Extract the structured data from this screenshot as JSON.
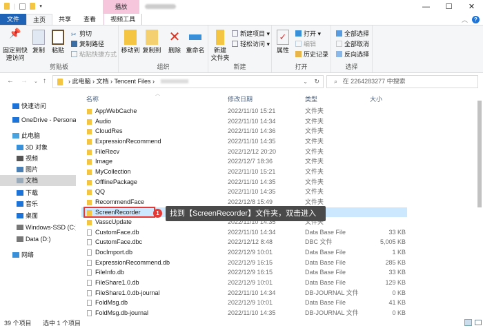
{
  "title_ctx_tab": "播放",
  "window_controls": {
    "minimize": "—",
    "maximize": "☐",
    "close": "✕"
  },
  "tabs": [
    "文件",
    "主页",
    "共享",
    "查看",
    "视频工具"
  ],
  "help": "?",
  "ribbon": {
    "clipboard": {
      "label": "剪贴板",
      "pin": "固定到快速访问",
      "copy": "复制",
      "paste": "粘贴",
      "cut": "剪切",
      "copy_path": "复制路径",
      "paste_shortcut": "粘贴快捷方式"
    },
    "organize": {
      "label": "组织",
      "move_to": "移动到",
      "copy_to": "复制到",
      "delete": "删除",
      "rename": "重命名"
    },
    "new": {
      "label": "新建",
      "new_folder": "新建\n文件夹",
      "new_item": "新建项目 ▾",
      "easy_access": "轻松访问 ▾"
    },
    "open": {
      "label": "打开",
      "properties": "属性",
      "open": "打开 ▾",
      "edit": "编辑",
      "history": "历史记录"
    },
    "select": {
      "label": "选择",
      "select_all": "全部选择",
      "select_none": "全部取消",
      "invert": "反向选择"
    }
  },
  "address": {
    "crumbs": "›  此电脑  ›  文档  ›  Tencent Files  ›",
    "search_placeholder": "在 2264283277 中搜索"
  },
  "sidebar": [
    {
      "label": "快速访问",
      "color": "#1e73d9"
    },
    {
      "label": "OneDrive - Persona",
      "color": "#1e73d9"
    },
    {
      "label": "此电脑",
      "color": "#4aa3df"
    },
    {
      "label": "3D 对象",
      "color": "#3a8fd9"
    },
    {
      "label": "视频",
      "color": "#555"
    },
    {
      "label": "图片",
      "color": "#4a7fb5"
    },
    {
      "label": "文档",
      "color": "#9ab"
    },
    {
      "label": "下载",
      "color": "#1e73d9"
    },
    {
      "label": "音乐",
      "color": "#1e73d9"
    },
    {
      "label": "桌面",
      "color": "#1e73d9"
    },
    {
      "label": "Windows-SSD (C:)",
      "color": "#777"
    },
    {
      "label": "Data (D:)",
      "color": "#777"
    },
    {
      "label": "网络",
      "color": "#3a8fd9"
    }
  ],
  "columns": {
    "name": "名称",
    "date": "修改日期",
    "type": "类型",
    "size": "大小"
  },
  "files": [
    {
      "name": "AppWebCache",
      "date": "2022/11/10 15:21",
      "type": "文件夹",
      "size": "",
      "folder": true
    },
    {
      "name": "Audio",
      "date": "2022/11/10 14:34",
      "type": "文件夹",
      "size": "",
      "folder": true
    },
    {
      "name": "CloudRes",
      "date": "2022/11/10 14:36",
      "type": "文件夹",
      "size": "",
      "folder": true
    },
    {
      "name": "ExpressionRecommend",
      "date": "2022/11/10 14:35",
      "type": "文件夹",
      "size": "",
      "folder": true
    },
    {
      "name": "FileRecv",
      "date": "2022/12/12 20:20",
      "type": "文件夹",
      "size": "",
      "folder": true
    },
    {
      "name": "Image",
      "date": "2022/12/7 18:36",
      "type": "文件夹",
      "size": "",
      "folder": true
    },
    {
      "name": "MyCollection",
      "date": "2022/11/10 15:21",
      "type": "文件夹",
      "size": "",
      "folder": true
    },
    {
      "name": "OfflinePackage",
      "date": "2022/11/10 14:35",
      "type": "文件夹",
      "size": "",
      "folder": true
    },
    {
      "name": "QQ",
      "date": "2022/11/10 14:35",
      "type": "文件夹",
      "size": "",
      "folder": true
    },
    {
      "name": "RecommendFace",
      "date": "2022/12/8 15:49",
      "type": "文件夹",
      "size": "",
      "folder": true
    },
    {
      "name": "ScreenRecorder",
      "date": "",
      "type": "",
      "size": "",
      "folder": true,
      "selected": true
    },
    {
      "name": "VasscUpdate",
      "date": "2022/11/10 14:35",
      "type": "文件夹",
      "size": "",
      "folder": true
    },
    {
      "name": "CustomFace.db",
      "date": "2022/11/10 14:34",
      "type": "Data Base File",
      "size": "33 KB"
    },
    {
      "name": "CustomFace.dbc",
      "date": "2022/12/12 8:48",
      "type": "DBC 文件",
      "size": "5,005 KB"
    },
    {
      "name": "DocImport.db",
      "date": "2022/12/9 10:01",
      "type": "Data Base File",
      "size": "1 KB"
    },
    {
      "name": "ExpressionRecommend.db",
      "date": "2022/12/9 16:15",
      "type": "Data Base File",
      "size": "285 KB"
    },
    {
      "name": "FileInfo.db",
      "date": "2022/12/9 16:15",
      "type": "Data Base File",
      "size": "33 KB"
    },
    {
      "name": "FileShare1.0.db",
      "date": "2022/12/9 10:01",
      "type": "Data Base File",
      "size": "129 KB"
    },
    {
      "name": "FileShare1.0.db-journal",
      "date": "2022/11/10 14:34",
      "type": "DB-JOURNAL 文件",
      "size": "0 KB"
    },
    {
      "name": "FoldMsg.db",
      "date": "2022/12/9 10:01",
      "type": "Data Base File",
      "size": "41 KB"
    },
    {
      "name": "FoldMsg.db-journal",
      "date": "2022/11/10 14:35",
      "type": "DB-JOURNAL 文件",
      "size": "0 KB"
    }
  ],
  "annotation": {
    "badge": "1",
    "text": "找到【ScreenRecorder】文件夹，双击进入"
  },
  "status": {
    "count": "39 个项目",
    "selected": "选中 1 个项目"
  }
}
